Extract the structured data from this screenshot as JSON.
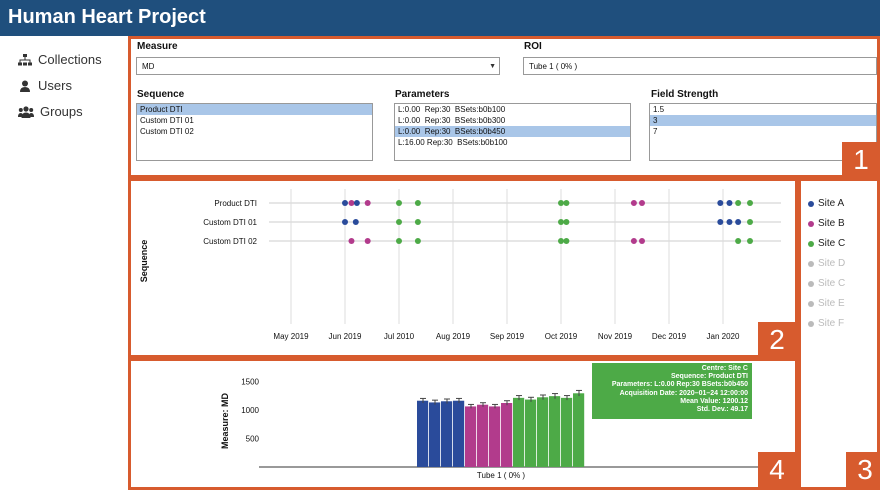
{
  "header": {
    "title": "Human Heart Project"
  },
  "sidebar": {
    "items": [
      {
        "label": "Collections",
        "icon": "sitemap-icon"
      },
      {
        "label": "Users",
        "icon": "user-icon"
      },
      {
        "label": "Groups",
        "icon": "users-icon"
      }
    ]
  },
  "filters": {
    "measure": {
      "label": "Measure",
      "value": "MD"
    },
    "roi": {
      "label": "ROI",
      "value": "Tube 1 ( 0% )"
    },
    "sequence": {
      "label": "Sequence",
      "options": [
        "Product DTI",
        "Custom DTI 01",
        "Custom DTI 02"
      ],
      "selected": 0
    },
    "parameters": {
      "label": "Parameters",
      "options": [
        "L:0.00  Rep:30  BSets:b0b100",
        "L:0.00  Rep:30  BSets:b0b300",
        "L:0.00  Rep:30  BSets:b0b450",
        "L:16.00 Rep:30  BSets:b0b100"
      ],
      "selected": 2
    },
    "field_strength": {
      "label": "Field Strength",
      "options": [
        "1.5",
        "3",
        "7"
      ],
      "selected": 1
    }
  },
  "panel_numbers": {
    "p1": "1",
    "p2": "2",
    "p3": "3",
    "p4": "4"
  },
  "colors": {
    "accent": "#d75b2e",
    "header": "#1f4f7d",
    "site_a": "#2a4b9b",
    "site_b": "#b23b8c",
    "site_c": "#4daa47",
    "inactive": "#bbbbbb"
  },
  "timeline": {
    "y_title": "Sequence",
    "rows": [
      "Product DTI",
      "Custom DTI 01",
      "Custom DTI 02"
    ],
    "x_ticks": [
      "May 2019",
      "Jun 2019",
      "Jul 2010",
      "Aug 2019",
      "Sep 2019",
      "Oct 2019",
      "Nov 2019",
      "Dec 2019",
      "Jan 2020"
    ],
    "points": [
      {
        "row": 0,
        "tick": 1.0,
        "site": "A"
      },
      {
        "row": 0,
        "tick": 1.12,
        "site": "B"
      },
      {
        "row": 0,
        "tick": 1.22,
        "site": "A"
      },
      {
        "row": 0,
        "tick": 1.42,
        "site": "B"
      },
      {
        "row": 0,
        "tick": 2.0,
        "site": "C"
      },
      {
        "row": 0,
        "tick": 2.35,
        "site": "C"
      },
      {
        "row": 0,
        "tick": 5.0,
        "site": "C"
      },
      {
        "row": 0,
        "tick": 5.1,
        "site": "C"
      },
      {
        "row": 0,
        "tick": 6.35,
        "site": "B"
      },
      {
        "row": 0,
        "tick": 6.5,
        "site": "B"
      },
      {
        "row": 0,
        "tick": 7.95,
        "site": "A"
      },
      {
        "row": 0,
        "tick": 8.12,
        "site": "A"
      },
      {
        "row": 0,
        "tick": 8.28,
        "site": "C"
      },
      {
        "row": 0,
        "tick": 8.5,
        "site": "C"
      },
      {
        "row": 1,
        "tick": 1.0,
        "site": "A"
      },
      {
        "row": 1,
        "tick": 1.2,
        "site": "A"
      },
      {
        "row": 1,
        "tick": 2.0,
        "site": "C"
      },
      {
        "row": 1,
        "tick": 2.35,
        "site": "C"
      },
      {
        "row": 1,
        "tick": 5.0,
        "site": "C"
      },
      {
        "row": 1,
        "tick": 5.1,
        "site": "C"
      },
      {
        "row": 1,
        "tick": 7.95,
        "site": "A"
      },
      {
        "row": 1,
        "tick": 8.12,
        "site": "A"
      },
      {
        "row": 1,
        "tick": 8.28,
        "site": "A"
      },
      {
        "row": 1,
        "tick": 8.5,
        "site": "C"
      },
      {
        "row": 2,
        "tick": 1.12,
        "site": "B"
      },
      {
        "row": 2,
        "tick": 1.42,
        "site": "B"
      },
      {
        "row": 2,
        "tick": 2.0,
        "site": "C"
      },
      {
        "row": 2,
        "tick": 2.35,
        "site": "C"
      },
      {
        "row": 2,
        "tick": 5.0,
        "site": "C"
      },
      {
        "row": 2,
        "tick": 5.1,
        "site": "C"
      },
      {
        "row": 2,
        "tick": 6.35,
        "site": "B"
      },
      {
        "row": 2,
        "tick": 6.5,
        "site": "B"
      },
      {
        "row": 2,
        "tick": 8.28,
        "site": "C"
      },
      {
        "row": 2,
        "tick": 8.5,
        "site": "C"
      }
    ]
  },
  "legend": [
    {
      "label": "Site A",
      "active": true,
      "site": "A"
    },
    {
      "label": "Site B",
      "active": true,
      "site": "B"
    },
    {
      "label": "Site C",
      "active": true,
      "site": "C"
    },
    {
      "label": "Site D",
      "active": false
    },
    {
      "label": "Site C",
      "active": false
    },
    {
      "label": "Site E",
      "active": false
    },
    {
      "label": "Site F",
      "active": false
    }
  ],
  "chart_data": {
    "type": "bar",
    "ylabel": "Measure: MD",
    "xlabel": "Tube 1 ( 0% )",
    "y_ticks": [
      500,
      1000,
      1500
    ],
    "ylim": [
      0,
      1750
    ],
    "bars": [
      {
        "site": "A",
        "value": 1160,
        "err": 40
      },
      {
        "site": "A",
        "value": 1130,
        "err": 40
      },
      {
        "site": "A",
        "value": 1150,
        "err": 40
      },
      {
        "site": "A",
        "value": 1160,
        "err": 40
      },
      {
        "site": "B",
        "value": 1060,
        "err": 35
      },
      {
        "site": "B",
        "value": 1090,
        "err": 35
      },
      {
        "site": "B",
        "value": 1060,
        "err": 35
      },
      {
        "site": "B",
        "value": 1120,
        "err": 40
      },
      {
        "site": "C",
        "value": 1210,
        "err": 40
      },
      {
        "site": "C",
        "value": 1180,
        "err": 40
      },
      {
        "site": "C",
        "value": 1220,
        "err": 40
      },
      {
        "site": "C",
        "value": 1240,
        "err": 45
      },
      {
        "site": "C",
        "value": 1210,
        "err": 40
      },
      {
        "site": "C",
        "value": 1290,
        "err": 50
      }
    ],
    "tooltip": [
      "Centre: Site C",
      "Sequence: Product DTI",
      "Parameters: L:0.00 Rep:30 BSets:b0b450",
      "Acquisition Date: 2020–01–24 12:00:00",
      "Mean Value: 1200.12",
      "Std. Dev.: 49.17"
    ]
  }
}
